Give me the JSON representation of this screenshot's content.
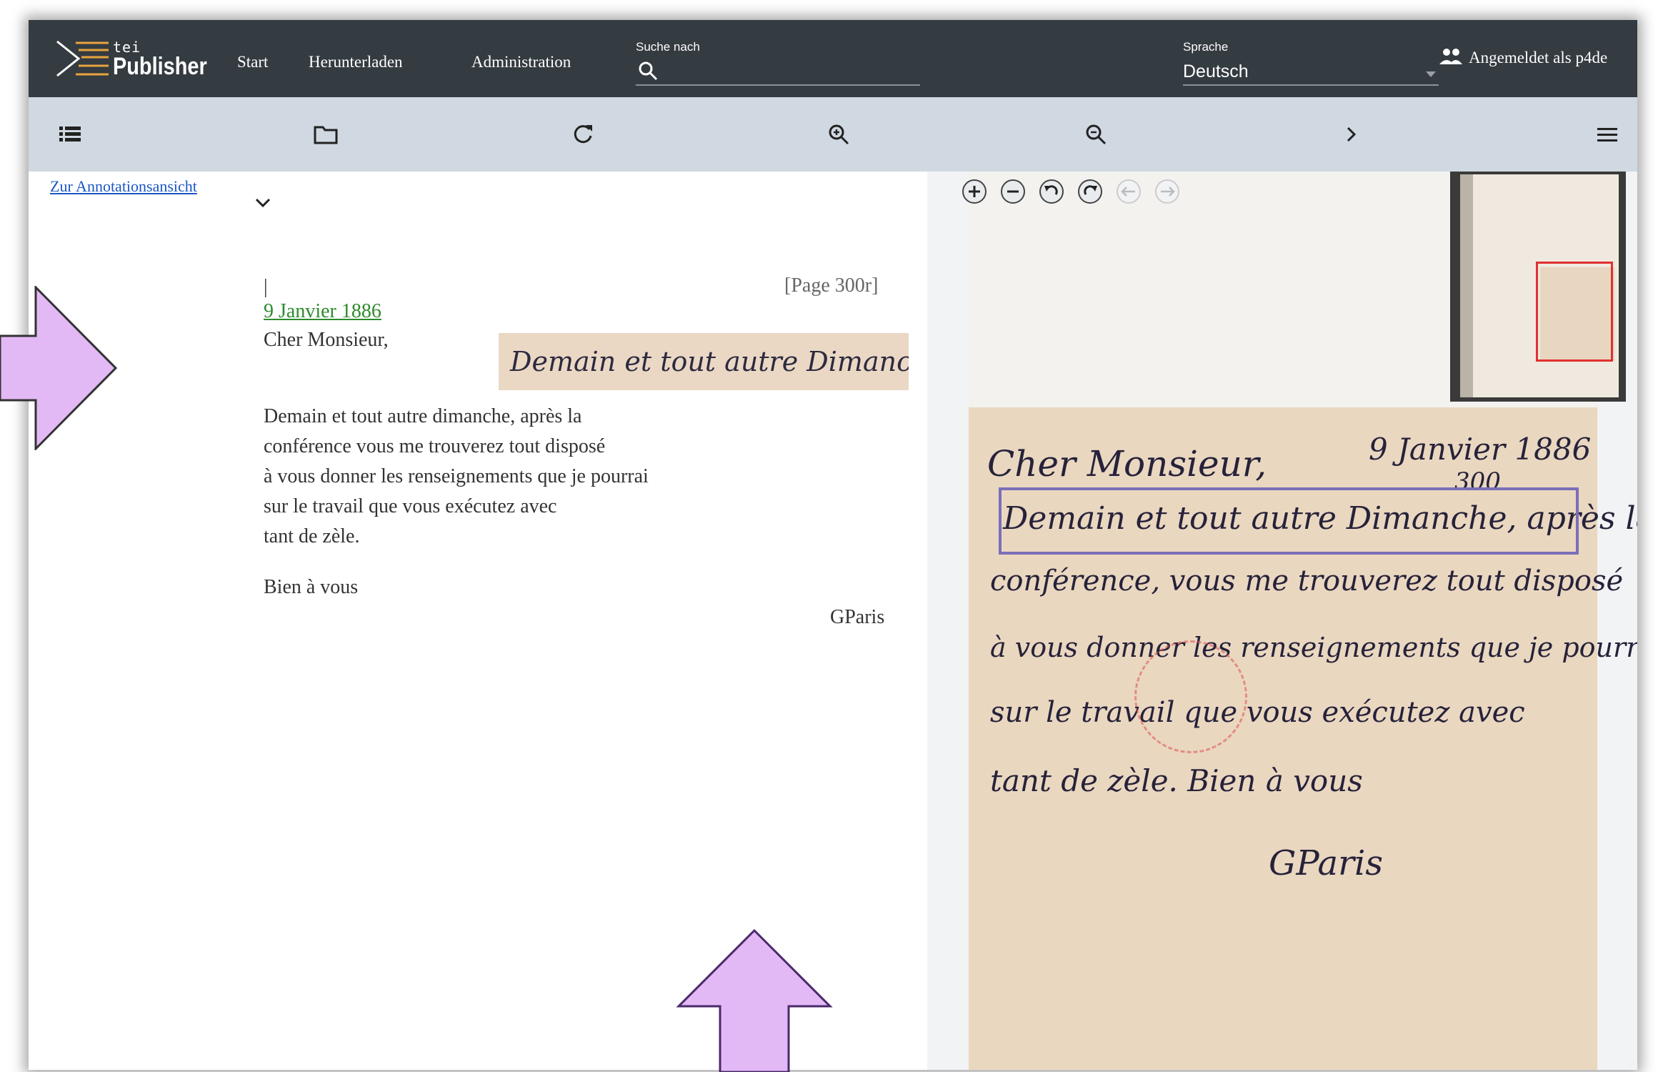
{
  "header": {
    "logo_small": "tei",
    "logo_large": "Publisher",
    "nav": [
      "Start",
      "Herunterladen",
      "Administration"
    ],
    "search_label": "Suche nach",
    "language_label": "Sprache",
    "language_value": "Deutsch",
    "login_text": "Angemeldet als p4de"
  },
  "toolbar": {
    "icons": [
      "toc-icon",
      "folder-icon",
      "reload-icon",
      "zoom-in-icon",
      "zoom-out-icon",
      "next-page-icon",
      "menu-icon"
    ]
  },
  "document": {
    "annotation_link": "Zur Annotationsansicht",
    "page_break_marker": "|",
    "page_label": "[Page 300r]",
    "date": "9 Janvier 1886",
    "salutation": "Cher Monsieur,",
    "handwriting_snippet": "Demain et tout autre Dimanche,",
    "body_lines": [
      "Demain et tout autre dimanche, après la",
      "conférence vous me trouverez tout disposé",
      "à vous donner les renseignements que je pourrai",
      "sur le travail que vous exécutez avec",
      "tant de zèle."
    ],
    "closing": "Bien à vous",
    "signature": "GParis"
  },
  "facsimile": {
    "lines": [
      "Cher Monsieur,",
      "9 Janvier 1886",
      "300",
      "Demain et tout autre Dimanche, après la",
      "conférence, vous me trouverez tout disposé",
      "à vous donner les renseignements que je pourrai",
      "sur le travail que vous exécutez avec",
      "tant de zèle.   Bien à vous",
      "GParis"
    ]
  },
  "colors": {
    "topbar": "#343b41",
    "toolbar": "#d0d9e1",
    "link": "#1a57c4",
    "date_link": "#2e8b2e",
    "annotation_zone": "#7a6fb8",
    "arrow_fill": "#e3b9f5"
  }
}
